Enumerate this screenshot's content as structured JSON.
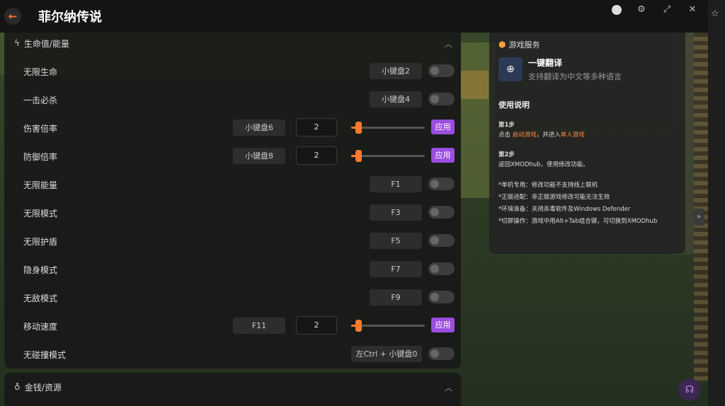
{
  "app": {
    "title": "菲尔纳传说"
  },
  "section1": {
    "title": "生命值/能量"
  },
  "section2": {
    "title": "金钱/资源"
  },
  "rows": [
    {
      "label": "无限生命",
      "key": "小键盘2"
    },
    {
      "label": "一击必杀",
      "key": "小键盘4"
    },
    {
      "label": "伤害倍率",
      "key": "小键盘6",
      "value": "2",
      "apply": "应用",
      "level": 0.1
    },
    {
      "label": "防御倍率",
      "key": "小键盘8",
      "value": "2",
      "apply": "应用",
      "level": 0.1
    },
    {
      "label": "无限能量",
      "key": "F1"
    },
    {
      "label": "无限模式",
      "key": "F3"
    },
    {
      "label": "无限护盾",
      "key": "F5"
    },
    {
      "label": "隐身模式",
      "key": "F7"
    },
    {
      "label": "无敌模式",
      "key": "F9"
    },
    {
      "label": "移动速度",
      "key": "F11",
      "value": "2",
      "apply": "应用",
      "level": 0.1
    },
    {
      "label": "无碰撞模式",
      "key": "左Ctrl + 小键盘0"
    }
  ],
  "side": {
    "header": "游戏服务",
    "translate_title": "一键翻译",
    "translate_desc": "支持翻译为中文等多种语言",
    "usage_title": "使用说明",
    "step1_label": "第1步",
    "step1_pre": "点击 ",
    "step1_link1": "启动游戏",
    "step1_mid": "，并进入",
    "step1_link2": "单人游戏",
    "step2_label": "第2步",
    "step2_text": "返回XMODhub，使用修改功能。",
    "note1": "*单机专用：修改功能不支持线上联机",
    "note2": "*正版适配：非正版游戏修改可能无法生效",
    "note3": "*环境准备：关闭杀毒软件及Windows Defender",
    "note4": "*切屏操作：游戏中用Alt+Tab组合键，可切换到XMODhub"
  },
  "colors": {
    "accent": "#ff7a2e",
    "apply": "#9b4de0",
    "panel": "#181818"
  },
  "icons": {
    "back": "back-arrow-icon",
    "section1": "lightning-icon",
    "section2": "money-bag-icon",
    "translate": "download-circle-icon",
    "service": "cube-icon",
    "support": "headset-icon"
  }
}
